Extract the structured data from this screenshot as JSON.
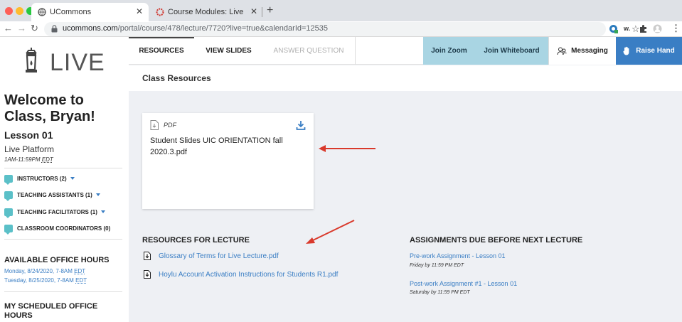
{
  "browser": {
    "active_tab_title": "UCommons",
    "inactive_tab_title": "Course Modules: Live Orientati",
    "url_host": "ucommons.com",
    "url_path": "/portal/course/478/lecture/7720?live=true&calendarId=12535",
    "ext_w_label": "w."
  },
  "sidebar": {
    "logo_text": "LIVE",
    "welcome": "Welcome to Class, Bryan!",
    "lesson": "Lesson 01",
    "platform": "Live Platform",
    "time_prefix": "1AM-11:59PM",
    "time_zone": "EDT",
    "roles": [
      {
        "label": "INSTRUCTORS (2)"
      },
      {
        "label": "TEACHING ASSISTANTS (1)"
      },
      {
        "label": "TEACHING FACILITATORS (1)"
      },
      {
        "label": "CLASSROOM COORDINATORS (0)"
      }
    ],
    "office_hours_heading": "AVAILABLE OFFICE HOURS",
    "office_hours": [
      {
        "text": "Monday, 8/24/2020, 7-8AM",
        "tz": "EDT"
      },
      {
        "text": "Tuesday, 8/25/2020, 7-8AM",
        "tz": "EDT"
      }
    ],
    "scheduled_heading": "MY SCHEDULED OFFICE HOURS"
  },
  "nav": {
    "resources": "RESOURCES",
    "view_slides": "VIEW SLIDES",
    "answer_question": "ANSWER QUESTION",
    "join_zoom": "Join Zoom",
    "join_whiteboard": "Join Whiteboard",
    "messaging": "Messaging",
    "raise_hand": "Raise Hand"
  },
  "class_resources": {
    "title": "Class Resources",
    "file_type": "PDF",
    "file_name": "Student Slides UIC ORIENTATION fall 2020.3.pdf"
  },
  "lecture_resources": {
    "heading": "RESOURCES FOR LECTURE",
    "items": [
      "Glossary of Terms for Live Lecture.pdf",
      "Hoylu Account Activation Instructions for Students R1.pdf"
    ]
  },
  "assignments": {
    "heading": "ASSIGNMENTS DUE BEFORE NEXT LECTURE",
    "items": [
      {
        "title": "Pre-work Assignment - Lesson 01",
        "due": "Friday by 11:59 PM EDT"
      },
      {
        "title": "Post-work Assignment #1 - Lesson 01",
        "due": "Saturday by 11:59 PM EDT"
      }
    ]
  },
  "colors": {
    "accent_blue": "#3a7ec4",
    "zoom_bg": "#a9d5e3",
    "role_icon": "#5bc0c8",
    "annotation_arrow": "#d9392b"
  }
}
